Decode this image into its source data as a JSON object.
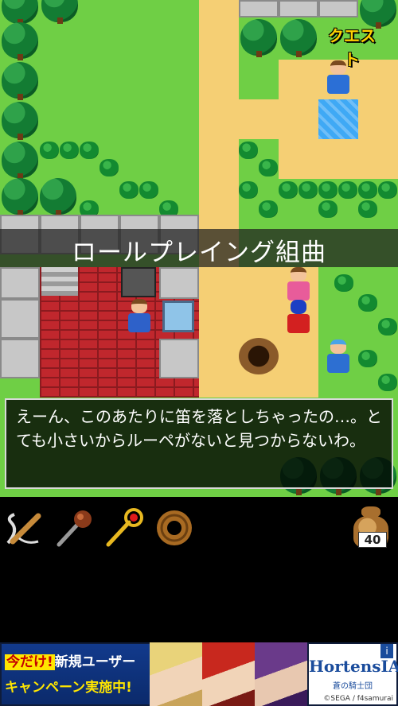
{
  "game": {
    "title_banner": "ロールプレイング組曲",
    "quest_button": "クエスト",
    "dialog": "えーん、このあたりに笛を落としちゃったの…。とても小さいからルーペがないと見つからないわ。"
  },
  "inventory": {
    "items": [
      {
        "name": "rope-whip-icon"
      },
      {
        "name": "mace-icon"
      },
      {
        "name": "golden-staff-icon"
      },
      {
        "name": "coiled-rope-icon"
      }
    ],
    "gold": "40"
  },
  "ad": {
    "promo_line1_highlight": "今だけ!",
    "promo_line1_rest": "新規ユーザー",
    "promo_line2": "キャンペーン実施中!",
    "logo_title": "HortensIA",
    "logo_subtitle": "蒼の騎士団",
    "info_icon": "i",
    "copyright": "©SEGA / f4samurai"
  },
  "colors": {
    "grass": "#6fcf45",
    "path": "#f5cf74",
    "quest_yellow": "#ffd200"
  }
}
